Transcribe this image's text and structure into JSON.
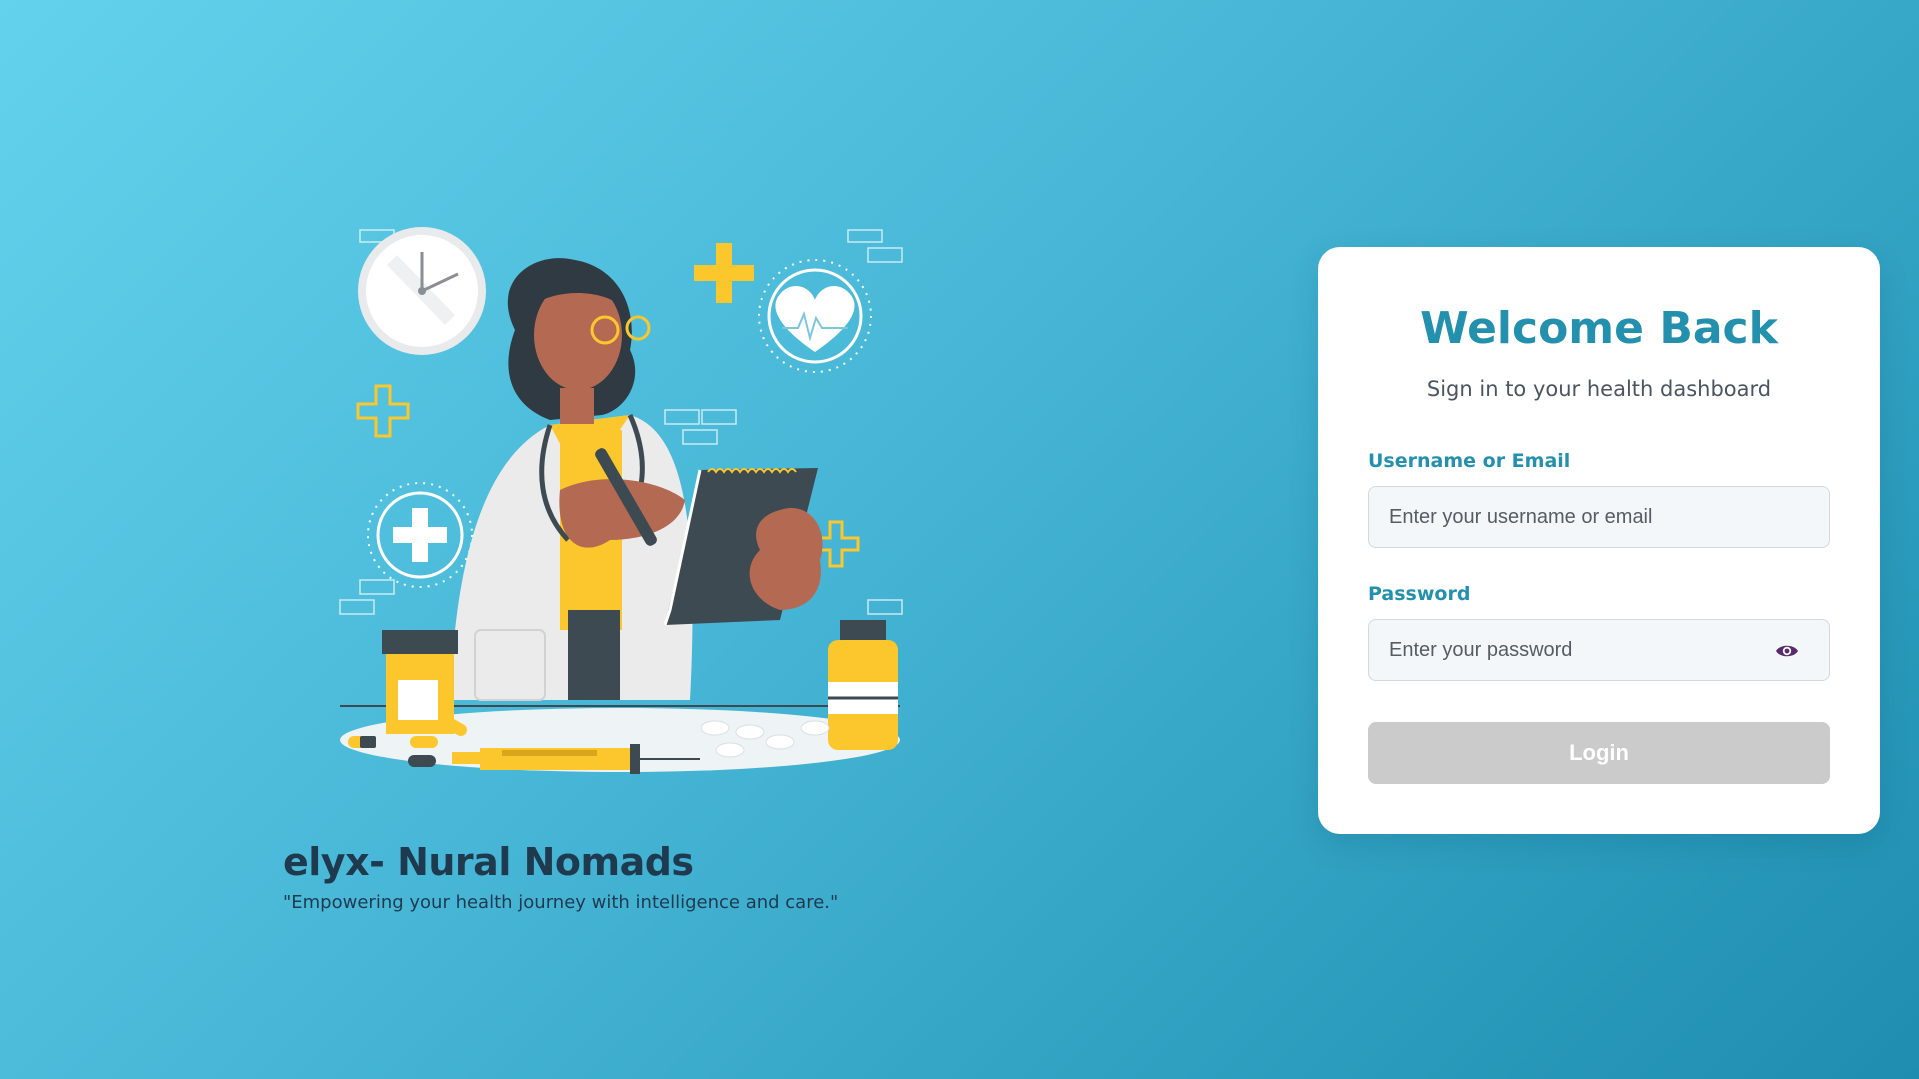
{
  "brand": {
    "title": "elyx- Nural Nomads",
    "tagline": "\"Empowering your health journey with intelligence and care.\""
  },
  "login": {
    "title": "Welcome Back",
    "subtitle": "Sign in to your health dashboard",
    "username_label": "Username or Email",
    "username_placeholder": "Enter your username or email",
    "username_value": "",
    "password_label": "Password",
    "password_placeholder": "Enter your password",
    "password_value": "",
    "show_password_icon": "eye-icon",
    "submit_label": "Login",
    "submit_color": "#cbcbcb"
  },
  "colors": {
    "accent": "#2390ad",
    "brand_text": "#1f3a4f",
    "illustration_yellow": "#fcc72c"
  },
  "illustration": {
    "subject": "doctor-with-clipboard-illustration"
  }
}
